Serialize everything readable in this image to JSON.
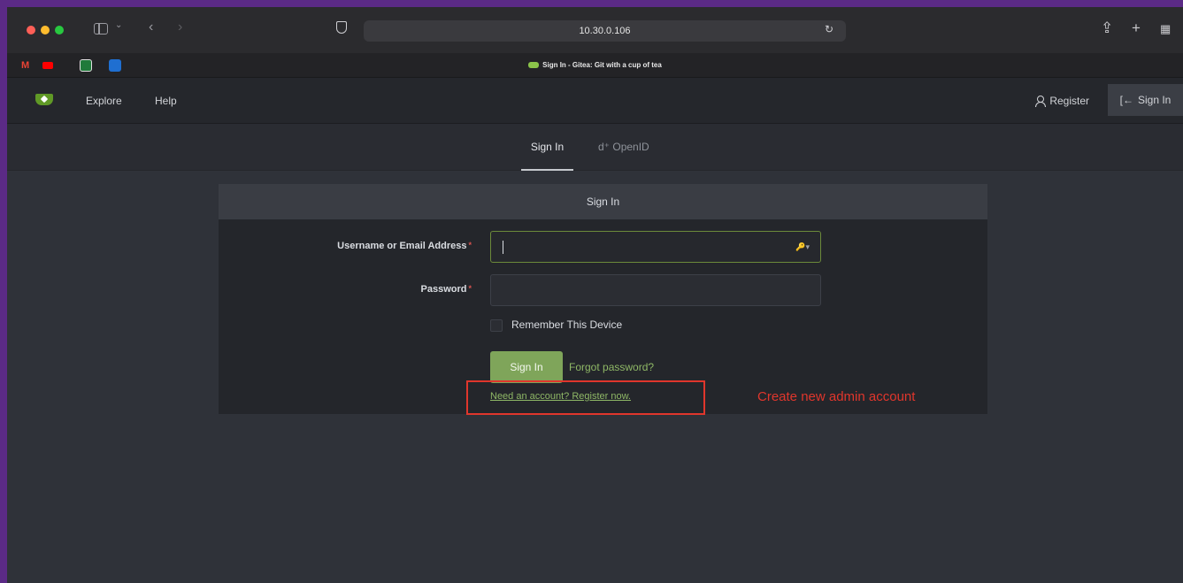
{
  "browser": {
    "url": "10.30.0.106",
    "tab_title": "Sign In - Gitea: Git with a cup of tea",
    "icons": [
      "sidebar-toggle-icon",
      "back-icon",
      "forward-icon",
      "shield-icon",
      "reload-icon",
      "share-icon",
      "new-tab-icon",
      "tab-overview-icon"
    ],
    "bookmarks": [
      "gmail-icon",
      "youtube-icon",
      "bookmark-green-icon",
      "trello-icon"
    ]
  },
  "nav": {
    "explore": "Explore",
    "help": "Help",
    "register": "Register",
    "signin": "Sign In"
  },
  "tabs": {
    "signin": "Sign In",
    "openid": "OpenID"
  },
  "form": {
    "header": "Sign In",
    "username_label": "Username or Email Address",
    "password_label": "Password",
    "required_mark": "*",
    "username_value": "",
    "password_value": "",
    "remember_label": "Remember This Device",
    "remember_checked": false,
    "submit_label": "Sign In",
    "forgot_label": "Forgot password?",
    "register_label": "Need an account? Register now."
  },
  "annotation": {
    "text": "Create new admin account",
    "color": "#e0362c"
  },
  "colors": {
    "accent_green": "#7fa55a",
    "link_green": "#8fb866",
    "background": "#2f3239"
  }
}
